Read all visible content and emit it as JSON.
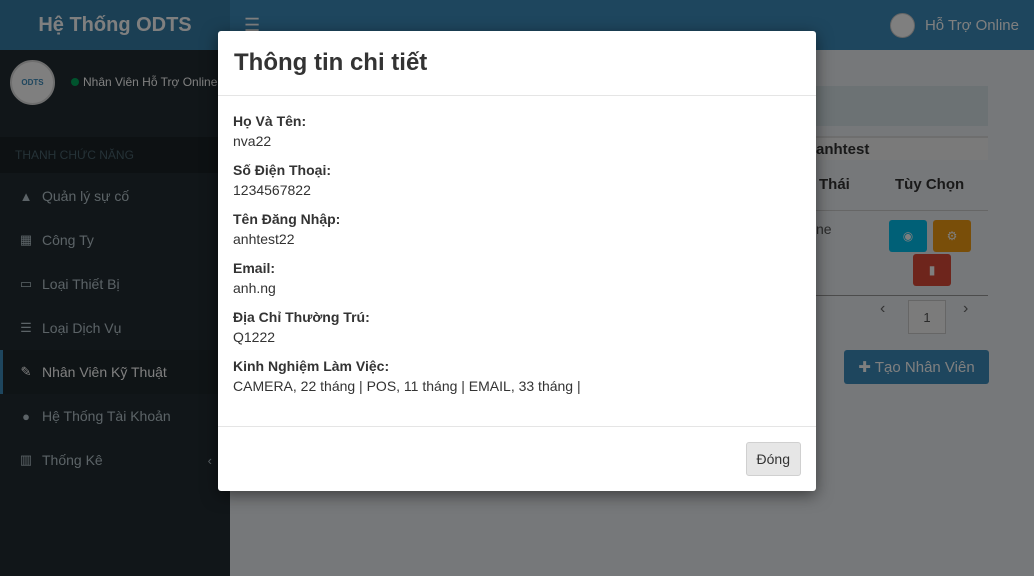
{
  "app": {
    "title": "Hệ Thống ODTS",
    "menu_icon": "hamburger-icon"
  },
  "header": {
    "user_label": "Hỗ Trợ Online"
  },
  "sidebar": {
    "avatar_text": "ODTS",
    "user_status": "Nhân Viên Hỗ Trợ Online",
    "section_header": "THANH CHỨC NĂNG",
    "items": [
      {
        "label": "Quản lý sự cố",
        "icon": "warning-icon"
      },
      {
        "label": "Công Ty",
        "icon": "building-icon"
      },
      {
        "label": "Loại Thiết Bị",
        "icon": "monitor-icon"
      },
      {
        "label": "Loại Dịch Vụ",
        "icon": "list-icon"
      },
      {
        "label": "Nhân Viên Kỹ Thuật",
        "icon": "wrench-icon",
        "active": true
      },
      {
        "label": "Hệ Thống Tài Khoản",
        "icon": "users-icon"
      },
      {
        "label": "Thống Kê",
        "icon": "chart-icon"
      }
    ]
  },
  "background": {
    "username": "anhtest",
    "col_status": "Thái",
    "col_options": "Tùy Chọn",
    "cell_status": "ne",
    "page": "1",
    "create_button": "Tạo Nhân Viên"
  },
  "modal": {
    "title": "Thông tin chi tiết",
    "fields": [
      {
        "label": "Họ Và Tên:",
        "value": "nva22"
      },
      {
        "label": "Số Điện Thoại:",
        "value": "1234567822"
      },
      {
        "label": "Tên Đăng Nhập:",
        "value": "anhtest22"
      },
      {
        "label": "Email:",
        "value": "anh.ng"
      },
      {
        "label": "Địa Chỉ Thường Trú:",
        "value": "Q1222"
      },
      {
        "label": "Kinh Nghiệm Làm Việc:",
        "value": "CAMERA, 22 tháng | POS, 11 tháng | EMAIL, 33 tháng |"
      }
    ],
    "close_button": "Đóng"
  },
  "colors": {
    "header": "#3c8dbc",
    "logo_bg": "#367fa9",
    "sidebar_bg": "#222d32",
    "btn_view": "#00c0ef",
    "btn_edit": "#f39c12",
    "btn_delete": "#dd4b39"
  }
}
